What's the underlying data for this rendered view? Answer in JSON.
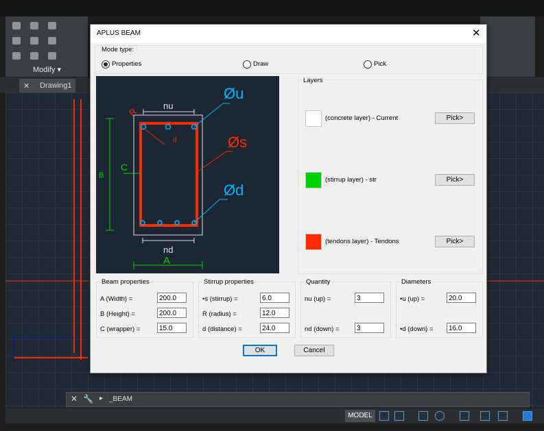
{
  "app": {
    "panel": "Modify",
    "tab": "Drawing1",
    "command": "_BEAM",
    "status_model": "MODEL"
  },
  "dialog": {
    "title": "APLUS BEAM",
    "mode_type_label": "Mode type:",
    "modes": [
      {
        "label": "Properties",
        "selected": true
      },
      {
        "label": "Draw",
        "selected": false
      },
      {
        "label": "Pick",
        "selected": false
      }
    ],
    "preview": {
      "labels": {
        "nu": "nu",
        "nd": "nd",
        "A": "A",
        "B": "B",
        "C": "C",
        "R": "R",
        "d": "d",
        "phi_u": "Øu",
        "phi_s": "Øs",
        "phi_d": "Ød"
      }
    },
    "layers": {
      "title": "Layers",
      "items": [
        {
          "label": "(concrete layer) - Current",
          "color": "#ffffff",
          "button": "Pick>"
        },
        {
          "label": "(stirrup layer) - str",
          "color": "#00d100",
          "button": "Pick>"
        },
        {
          "label": "(tendons layer) - Tendons",
          "color": "#ff2a00",
          "button": "Pick>"
        }
      ]
    },
    "beam_properties": {
      "title": "Beam properties",
      "rows": [
        {
          "label": "A (Width) =",
          "value": "200.0"
        },
        {
          "label": "B (Height) =",
          "value": "200.0"
        },
        {
          "label": "C (wrapper) =",
          "value": "15.0"
        }
      ]
    },
    "stirrup_properties": {
      "title": "Stirrup properties",
      "rows": [
        {
          "label": "•s (stirrup) =",
          "value": "6.0"
        },
        {
          "label": "R (radius) =",
          "value": "12.0"
        },
        {
          "label": "d (distance) =",
          "value": "24.0"
        }
      ]
    },
    "quantity": {
      "title": "Quantity",
      "rows": [
        {
          "label": "nu (up) =",
          "value": "3"
        },
        {
          "label": "nd (down) =",
          "value": "3"
        }
      ]
    },
    "diameters": {
      "title": "Diameters",
      "rows": [
        {
          "label": "•u (up) =",
          "value": "20.0"
        },
        {
          "label": "•d (down) =",
          "value": "16.0"
        }
      ]
    },
    "ok_label": "OK",
    "cancel_label": "Cancel"
  },
  "colors": {
    "concrete": "#ffffff",
    "stirrup": "#00d100",
    "tendon": "#ff2a00",
    "annotation": "#00b7ff"
  }
}
